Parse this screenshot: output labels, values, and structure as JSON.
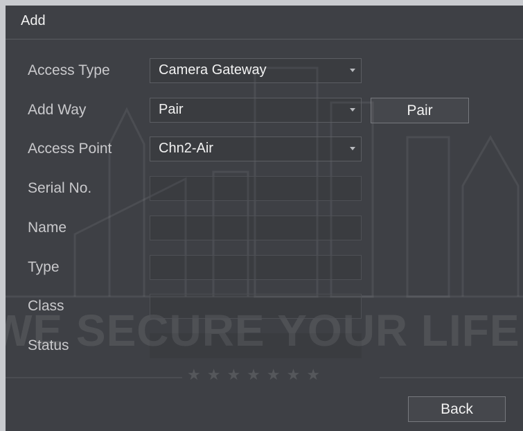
{
  "dialog": {
    "title": "Add",
    "decor_slogan": "WE SECURE YOUR LIFE",
    "decor_stars": "★★★★★★★"
  },
  "form": {
    "access_type": {
      "label": "Access Type",
      "value": "Camera Gateway"
    },
    "add_way": {
      "label": "Add Way",
      "value": "Pair"
    },
    "access_point": {
      "label": "Access Point",
      "value": "Chn2-Air"
    },
    "serial_no": {
      "label": "Serial No.",
      "value": ""
    },
    "name": {
      "label": "Name",
      "value": ""
    },
    "type": {
      "label": "Type",
      "value": ""
    },
    "class": {
      "label": "Class",
      "value": ""
    },
    "status": {
      "label": "Status",
      "value": ""
    }
  },
  "buttons": {
    "pair": "Pair",
    "back": "Back"
  },
  "colors": {
    "dialog_bg": "#3e4045",
    "text": "#f1f1f1",
    "label": "#c9c9cc"
  },
  "icons": {
    "dropdown": "chevron-down-icon"
  }
}
